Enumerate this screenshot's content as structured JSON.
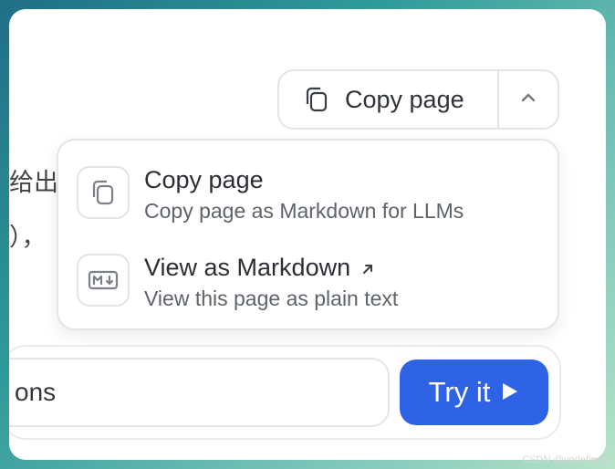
{
  "background_text": {
    "line1": "给出",
    "line2": "），"
  },
  "copy_button": {
    "label": "Copy page",
    "icon": "copy-icon",
    "caret_icon": "chevron-up-icon"
  },
  "menu": {
    "items": [
      {
        "title": "Copy page",
        "subtitle": "Copy page as Markdown for LLMs",
        "icon": "copy-icon"
      },
      {
        "title": "View as Markdown",
        "subtitle": "View this page as plain text",
        "icon": "markdown-icon",
        "external_icon": "external-link-icon"
      }
    ]
  },
  "input": {
    "value": "ons"
  },
  "try_button": {
    "label": "Try it",
    "icon": "play-icon"
  },
  "colors": {
    "accent": "#2f63e6",
    "border": "#e2e4e8",
    "text": "#2b2e33",
    "subtext": "#5e6369"
  },
  "watermark": "CSDN @undefined"
}
